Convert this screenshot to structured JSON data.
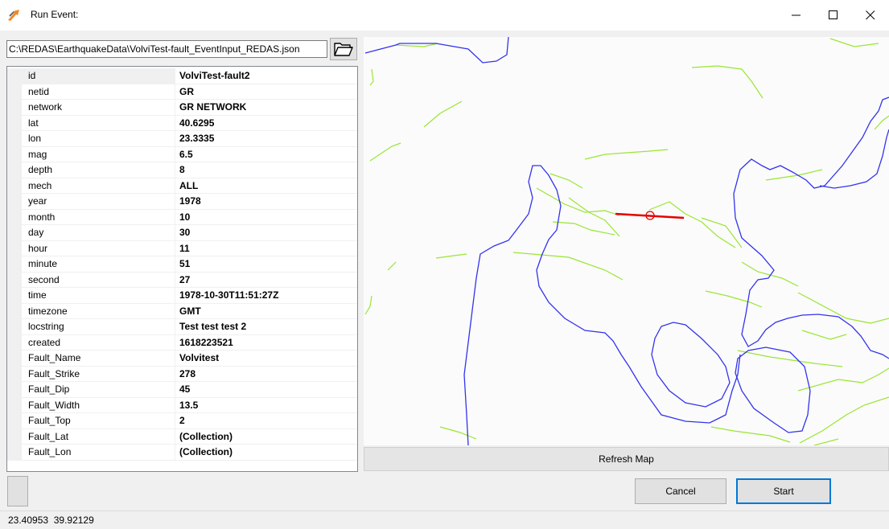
{
  "window": {
    "title": "Run Event:",
    "minimize_icon": "minimize-icon",
    "maximize_icon": "maximize-icon",
    "close_icon": "close-icon",
    "app_icon": "app-icon"
  },
  "file": {
    "path": "C:\\REDAS\\EarthquakeData\\VolviTest-fault_EventInput_REDAS.json",
    "browse_icon": "folder-open-icon"
  },
  "properties": [
    {
      "name": "id",
      "value": "VolviTest-fault2"
    },
    {
      "name": "netid",
      "value": "GR"
    },
    {
      "name": "network",
      "value": "GR NETWORK"
    },
    {
      "name": "lat",
      "value": "40.6295"
    },
    {
      "name": "lon",
      "value": "23.3335"
    },
    {
      "name": "mag",
      "value": "6.5"
    },
    {
      "name": "depth",
      "value": "8"
    },
    {
      "name": "mech",
      "value": "ALL"
    },
    {
      "name": "year",
      "value": "1978"
    },
    {
      "name": "month",
      "value": "10"
    },
    {
      "name": "day",
      "value": "30"
    },
    {
      "name": "hour",
      "value": "11"
    },
    {
      "name": "minute",
      "value": "51"
    },
    {
      "name": "second",
      "value": "27"
    },
    {
      "name": "time",
      "value": "1978-10-30T11:51:27Z"
    },
    {
      "name": "timezone",
      "value": "GMT"
    },
    {
      "name": "locstring",
      "value": "Test test test 2"
    },
    {
      "name": "created",
      "value": "1618223521"
    },
    {
      "name": "Fault_Name",
      "value": "Volvitest"
    },
    {
      "name": "Fault_Strike",
      "value": "278"
    },
    {
      "name": "Fault_Dip",
      "value": "45"
    },
    {
      "name": "Fault_Width",
      "value": "13.5"
    },
    {
      "name": "Fault_Top",
      "value": "2"
    },
    {
      "name": "Fault_Lat",
      "value": "(Collection)"
    },
    {
      "name": "Fault_Lon",
      "value": "(Collection)"
    }
  ],
  "map": {
    "coastline_color": "#3333ee",
    "fault_color": "#99e633",
    "rupture_color": "#e60000"
  },
  "buttons": {
    "refresh": "Refresh Map",
    "cancel": "Cancel",
    "start": "Start"
  },
  "status": {
    "coordinates": "23.40953  39.92129"
  }
}
